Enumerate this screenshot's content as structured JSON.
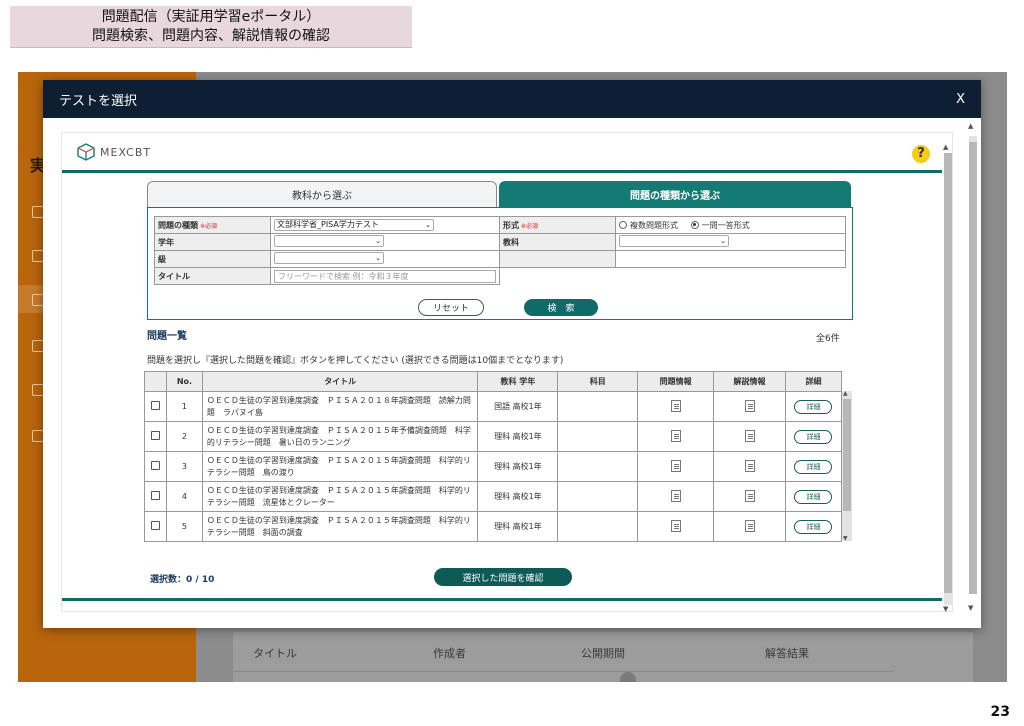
{
  "slide": {
    "title_line1": "問題配信（実証用学習eポータル）",
    "title_line2": "問題検索、問題内容、解説情報の確認",
    "page_number": "23"
  },
  "background": {
    "sidebar_title": "実",
    "columns": [
      "タイトル",
      "作成者",
      "公開期間",
      "解答結果"
    ]
  },
  "modal": {
    "title": "テストを選択",
    "close": "X",
    "logo_text": "MEXCBT",
    "help": "?"
  },
  "tabs": [
    {
      "label": "教科から選ぶ",
      "active": false
    },
    {
      "label": "問題の種類から選ぶ",
      "active": true
    }
  ],
  "search": {
    "type_label": "問題の種類",
    "required": "※必須",
    "type_value": "文部科学省_PISA学力テスト",
    "format_label": "形式",
    "format_options": [
      "複数問題形式",
      "一問一答形式"
    ],
    "format_selected": 1,
    "grade_label": "学年",
    "subject_label": "教科",
    "level_label": "級",
    "title_label": "タイトル",
    "title_placeholder": "フリーワードで検索 例：令和３年度",
    "reset_label": "リセット",
    "search_label": "検　索"
  },
  "list": {
    "title": "問題一覧",
    "count": "全6件",
    "note": "問題を選択し『選択した問題を確認』ボタンを押してください (選択できる問題は10個までとなります)",
    "columns": [
      "",
      "No.",
      "タイトル",
      "教科 学年",
      "科目",
      "問題情報",
      "解説情報",
      "詳細"
    ],
    "detail_label": "詳細",
    "rows": [
      {
        "no": "1",
        "title": "ＯＥＣＤ生徒の学習到達度調査　ＰＩＳＡ２０１８年調査問題　読解力問題　ラパヌイ島",
        "grade": "国語 高校1年"
      },
      {
        "no": "2",
        "title": "ＯＥＣＤ生徒の学習到達度調査　ＰＩＳＡ２０１５年予備調査問題　科学的リテラシー問題　暑い日のランニング",
        "grade": "理科 高校1年"
      },
      {
        "no": "3",
        "title": "ＯＥＣＤ生徒の学習到達度調査　ＰＩＳＡ２０１５年調査問題　科学的リテラシー問題　鳥の渡り",
        "grade": "理科 高校1年"
      },
      {
        "no": "4",
        "title": "ＯＥＣＤ生徒の学習到達度調査　ＰＩＳＡ２０１５年調査問題　科学的リテラシー問題　流星体とクレーター",
        "grade": "理科 高校1年"
      },
      {
        "no": "5",
        "title": "ＯＥＣＤ生徒の学習到達度調査　ＰＩＳＡ２０１５年調査問題　科学的リテラシー問題　斜面の調査",
        "grade": "理科 高校1年"
      }
    ],
    "selection_count": "選択数：0 / 10",
    "confirm_label": "選択した問題を確認"
  },
  "colors": {
    "accent": "#137a74",
    "header": "#0f1f33",
    "sidebar": "#b8650c",
    "help": "#f5cc1a"
  }
}
